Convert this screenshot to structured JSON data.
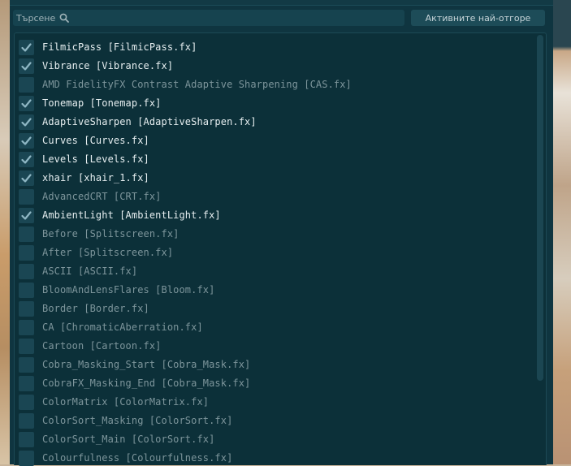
{
  "search": {
    "placeholder": "Търсене"
  },
  "toolbar": {
    "active_top_button": "Активните най-отгоре"
  },
  "effects": [
    {
      "label": "FilmicPass [FilmicPass.fx]",
      "checked": true
    },
    {
      "label": "Vibrance [Vibrance.fx]",
      "checked": true
    },
    {
      "label": "AMD FidelityFX Contrast Adaptive Sharpening [CAS.fx]",
      "checked": false
    },
    {
      "label": "Tonemap [Tonemap.fx]",
      "checked": true
    },
    {
      "label": "AdaptiveSharpen [AdaptiveSharpen.fx]",
      "checked": true
    },
    {
      "label": "Curves [Curves.fx]",
      "checked": true
    },
    {
      "label": "Levels [Levels.fx]",
      "checked": true
    },
    {
      "label": "xhair [xhair_1.fx]",
      "checked": true
    },
    {
      "label": "AdvancedCRT [CRT.fx]",
      "checked": false
    },
    {
      "label": "AmbientLight [AmbientLight.fx]",
      "checked": true
    },
    {
      "label": "Before [Splitscreen.fx]",
      "checked": false
    },
    {
      "label": "After [Splitscreen.fx]",
      "checked": false
    },
    {
      "label": "ASCII [ASCII.fx]",
      "checked": false
    },
    {
      "label": "BloomAndLensFlares [Bloom.fx]",
      "checked": false
    },
    {
      "label": "Border [Border.fx]",
      "checked": false
    },
    {
      "label": "CA [ChromaticAberration.fx]",
      "checked": false
    },
    {
      "label": "Cartoon [Cartoon.fx]",
      "checked": false
    },
    {
      "label": "Cobra_Masking_Start [Cobra_Mask.fx]",
      "checked": false
    },
    {
      "label": "CobraFX_Masking_End [Cobra_Mask.fx]",
      "checked": false
    },
    {
      "label": "ColorMatrix [ColorMatrix.fx]",
      "checked": false
    },
    {
      "label": "ColorSort_Masking [ColorSort.fx]",
      "checked": false
    },
    {
      "label": "ColorSort_Main [ColorSort.fx]",
      "checked": false
    },
    {
      "label": "Colourfulness [Colourfulness.fx]",
      "checked": false
    }
  ],
  "colors": {
    "panel_bg": "#0f3540",
    "checkbox_bg": "#1a4653",
    "checkmark": "#8fb7c4",
    "text_active": "#e6eef0",
    "text_inactive": "#7d959b"
  },
  "icons": {
    "search": "search-icon",
    "check": "check-icon"
  }
}
